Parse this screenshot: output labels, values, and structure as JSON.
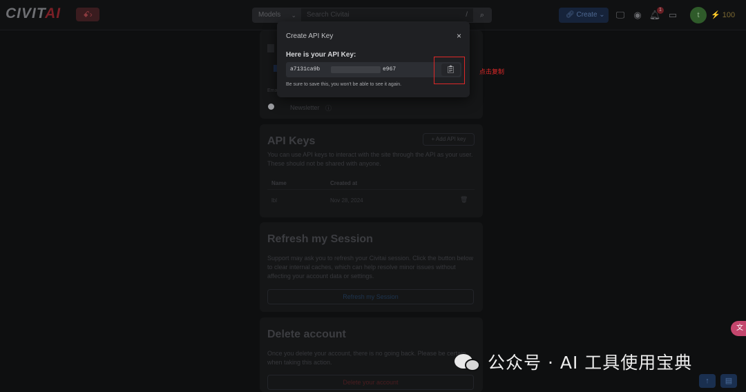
{
  "header": {
    "logo_text": "CIVIT",
    "logo_ai": "AI",
    "logo_badge": "ꗃ›",
    "search_select": "Models",
    "search_placeholder": "Search Civitai",
    "search_shortcut": "/",
    "create_label": "Create",
    "notification_count": "1",
    "avatar_initial": "t",
    "buzz_amount": "⚡ 100"
  },
  "settings": {
    "email_label": "Emai",
    "newsletter_label": "Newsletter",
    "api_keys": {
      "title": "API Keys",
      "add_button": "Add API key",
      "description": "You can use API keys to interact with the site through the API as your user. These should not be shared with anyone.",
      "columns": [
        "Name",
        "Created at"
      ],
      "rows": [
        {
          "name": "lbl",
          "created": "Nov 28, 2024"
        }
      ]
    },
    "refresh": {
      "title": "Refresh my Session",
      "description": "Support may ask you to refresh your Civitai session. Click the button below to clear internal caches, which can help resolve minor issues without affecting your account data or settings.",
      "button": "Refresh my Session"
    },
    "delete": {
      "title": "Delete account",
      "description": "Once you delete your account, there is no going back. Please be certain when taking this action.",
      "button": "Delete your account"
    }
  },
  "modal": {
    "title": "Create API Key",
    "close": "×",
    "label": "Here is your API Key:",
    "key_start": "a7131ca9b",
    "key_end": "e967",
    "hint": "Be sure to save this, you won't be able to see it again."
  },
  "annotation": "点击复制",
  "watermark": "公众号 · AI 工具使用宝典",
  "colors": {
    "accent_blue": "#228be6",
    "danger_red": "#e02828",
    "modal_bg": "#1f2023"
  }
}
